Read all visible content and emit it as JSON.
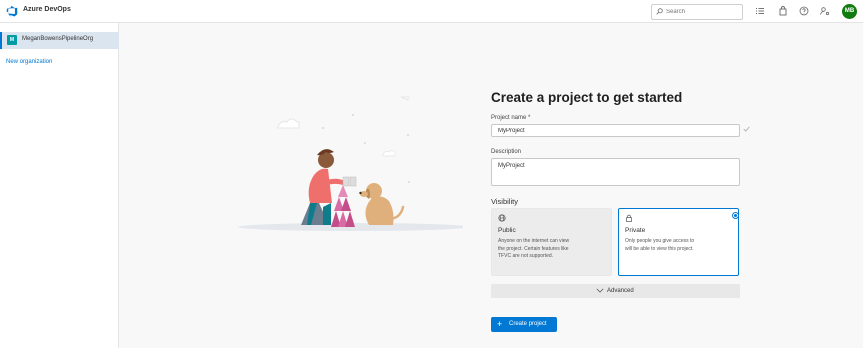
{
  "header": {
    "brand": "Azure DevOps",
    "search_placeholder": "Search",
    "avatar_initials": "MB",
    "icons": [
      "azure-devops-logo-icon",
      "list-icon",
      "shopping-bag-icon",
      "help-icon",
      "user-settings-icon"
    ],
    "accent_color": "#0078d4",
    "avatar_color": "#107c10"
  },
  "sidebar": {
    "organization": {
      "badge": "M",
      "name": "MeganBowensPipelineOrg",
      "badge_color": "#009ca6"
    },
    "new_organization": "New organization"
  },
  "form": {
    "title": "Create a project to get started",
    "project_name_label": "Project name *",
    "project_name_value": "MyProject",
    "description_label": "Description",
    "description_value": "MyProject",
    "visibility_label": "Visibility",
    "visibility_options": [
      {
        "title": "Public",
        "icon": "globe-icon",
        "description": "Anyone on the internet can view the project. Certain features like TFVC are not supported.",
        "selected": false
      },
      {
        "title": "Private",
        "icon": "lock-icon",
        "description": "Only people you give access to will be able to view this project.",
        "selected": true
      }
    ],
    "advanced_label": "Advanced",
    "create_button": "Create project",
    "create_button_icon": "plus-icon"
  }
}
